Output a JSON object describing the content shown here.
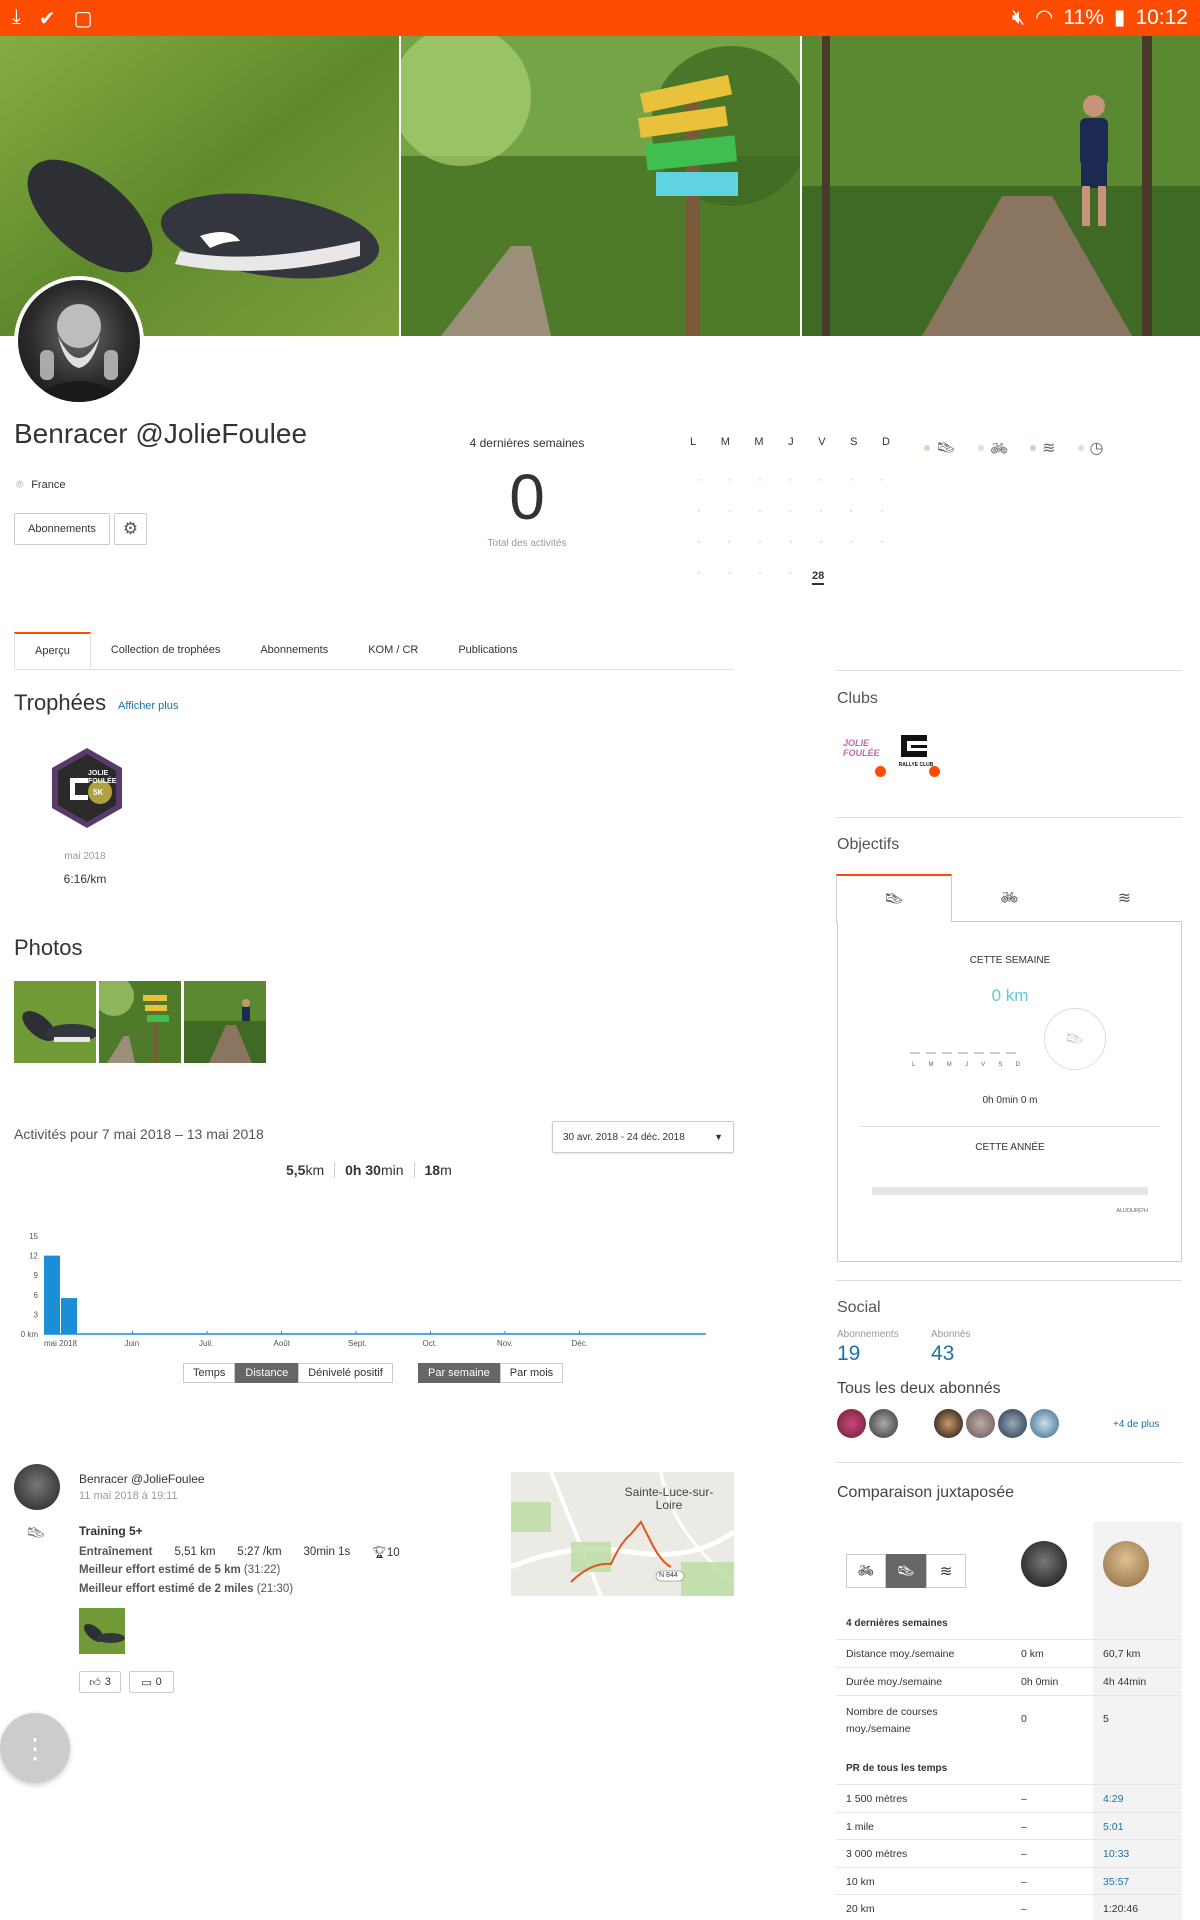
{
  "status_bar": {
    "battery": "11%",
    "time": "10:12"
  },
  "profile": {
    "name": "Benracer @JolieFoulee",
    "location": "France",
    "follow_button": "Abonnements"
  },
  "weeks_summary": {
    "heading": "4 dernières semaines",
    "total": "0",
    "total_label": "Total des activités",
    "days": [
      "L",
      "M",
      "M",
      "J",
      "V",
      "S",
      "D"
    ],
    "today": "28"
  },
  "tabs": [
    "Aperçu",
    "Collection de trophées",
    "Abonnements",
    "KOM / CR",
    "Publications"
  ],
  "trophies": {
    "heading": "Trophées",
    "more": "Afficher plus",
    "badge_text": "JOLIE FOULÉE",
    "badge_sub": "5K",
    "date": "mai 2018",
    "pace": "6:16/km"
  },
  "photos": {
    "heading": "Photos"
  },
  "activities": {
    "heading": "Activités pour 7 mai 2018 – 13 mai 2018",
    "range_select": "30 avr. 2018 - 24 déc. 2018",
    "distance_value": "5,5",
    "distance_unit": "km",
    "time_h": "0h",
    "time_min": "30",
    "time_unit": "min",
    "elev_value": "18",
    "elev_unit": "m",
    "metric_buttons": [
      "Temps",
      "Distance",
      "Dénivelé positif"
    ],
    "period_buttons": [
      "Par semaine",
      "Par mois"
    ]
  },
  "chart_data": {
    "type": "bar",
    "ylabel_unit": "0 km",
    "y_ticks": [
      "15",
      "12",
      "9",
      "6",
      "3"
    ],
    "ylim": [
      0,
      15
    ],
    "x_labels": [
      "mai 2018",
      "Juin",
      "Juil.",
      "Août",
      "Sept.",
      "Oct.",
      "Nov.",
      "Déc."
    ],
    "values": [
      12,
      5.5
    ],
    "color": "#1a8fd6"
  },
  "feed": {
    "athlete": "Benracer @JolieFoulee",
    "date": "11 mai 2018 à 19:11",
    "title": "Training 5+",
    "type": "Entraînement",
    "distance": "5,51 km",
    "pace": "5:27 /km",
    "duration": "30min 1s",
    "trophies": "10",
    "effort1_label": "Meilleur effort estimé de 5 km",
    "effort1_value": "(31:22)",
    "effort2_label": "Meilleur effort estimé de 2 miles",
    "effort2_value": "(21:30)",
    "map_place": "Sainte-Luce-sur-Loire",
    "map_road": "N 844",
    "kudos": "3",
    "comments": "0"
  },
  "clubs": {
    "heading": "Clubs",
    "club1": "JOLIE FOULÉE",
    "club2": "RALLYE CLUB"
  },
  "goals": {
    "heading": "Objectifs",
    "this_week": "CETTE SEMAINE",
    "km": "0 km",
    "days": [
      "L",
      "M",
      "M",
      "J",
      "V",
      "S",
      "D"
    ],
    "time": "0h 0min 0 m",
    "this_year": "CETTE ANNÉE",
    "today": "AUJOURD'H"
  },
  "social": {
    "heading": "Social",
    "following_label": "Abonnements",
    "following": "19",
    "followers_label": "Abonnés",
    "followers": "43",
    "mutual": "Tous les deux abonnés",
    "more": "+4 de plus"
  },
  "comparison": {
    "heading": "Comparaison juxtaposée",
    "section1": "4 dernières semaines",
    "rows1": [
      {
        "label": "Distance moy./semaine",
        "me": "0 km",
        "them": "60,7 km"
      },
      {
        "label": "Durée moy./semaine",
        "me": "0h 0min",
        "them": "4h 44min"
      },
      {
        "label": "Nombre de courses moy./semaine",
        "me": "0",
        "them": "5"
      }
    ],
    "section2": "PR de tous les temps",
    "rows2": [
      {
        "label": "1 500 mètres",
        "me": "–",
        "them": "4:29"
      },
      {
        "label": "1 mile",
        "me": "–",
        "them": "5:01"
      },
      {
        "label": "3 000 mètres",
        "me": "–",
        "them": "10:33"
      },
      {
        "label": "10 km",
        "me": "–",
        "them": "35:57"
      },
      {
        "label": "20 km",
        "me": "–",
        "them": "1:20:46"
      }
    ]
  },
  "colors": {
    "accent": "#fc4c02",
    "link": "#1a73a8",
    "chart": "#1a8fd6"
  }
}
